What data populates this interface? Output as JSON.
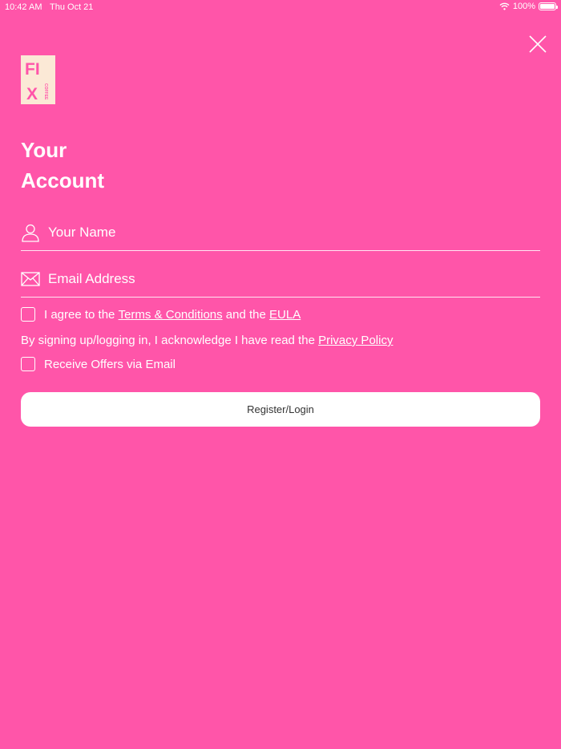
{
  "status_bar": {
    "time": "10:42 AM",
    "date": "Thu Oct 21",
    "battery": "100%"
  },
  "logo": {
    "letters_top": "FI",
    "letters_bottom": "X",
    "subtext": "COFFEE"
  },
  "colors": {
    "background": "#ff55a9",
    "accent_text": "#ffffff",
    "logo_background": "#fbe9d6",
    "logo_letters": "#ff55a9"
  },
  "title": {
    "line1": "Your",
    "line2": "Account"
  },
  "form": {
    "name_placeholder": "Your Name",
    "email_placeholder": "Email Address",
    "name_icon": "person-icon",
    "email_icon": "envelope-icon"
  },
  "terms": {
    "prefix": "I agree to the ",
    "terms_link": "Terms & Conditions",
    "middle": " and the ",
    "eula_link": "EULA"
  },
  "acknowledge": {
    "prefix": "By signing up/logging in, I acknowledge I have read the ",
    "privacy_link": "Privacy Policy"
  },
  "offers": {
    "label": "Receive Offers via Email"
  },
  "register_button": "Register/Login"
}
